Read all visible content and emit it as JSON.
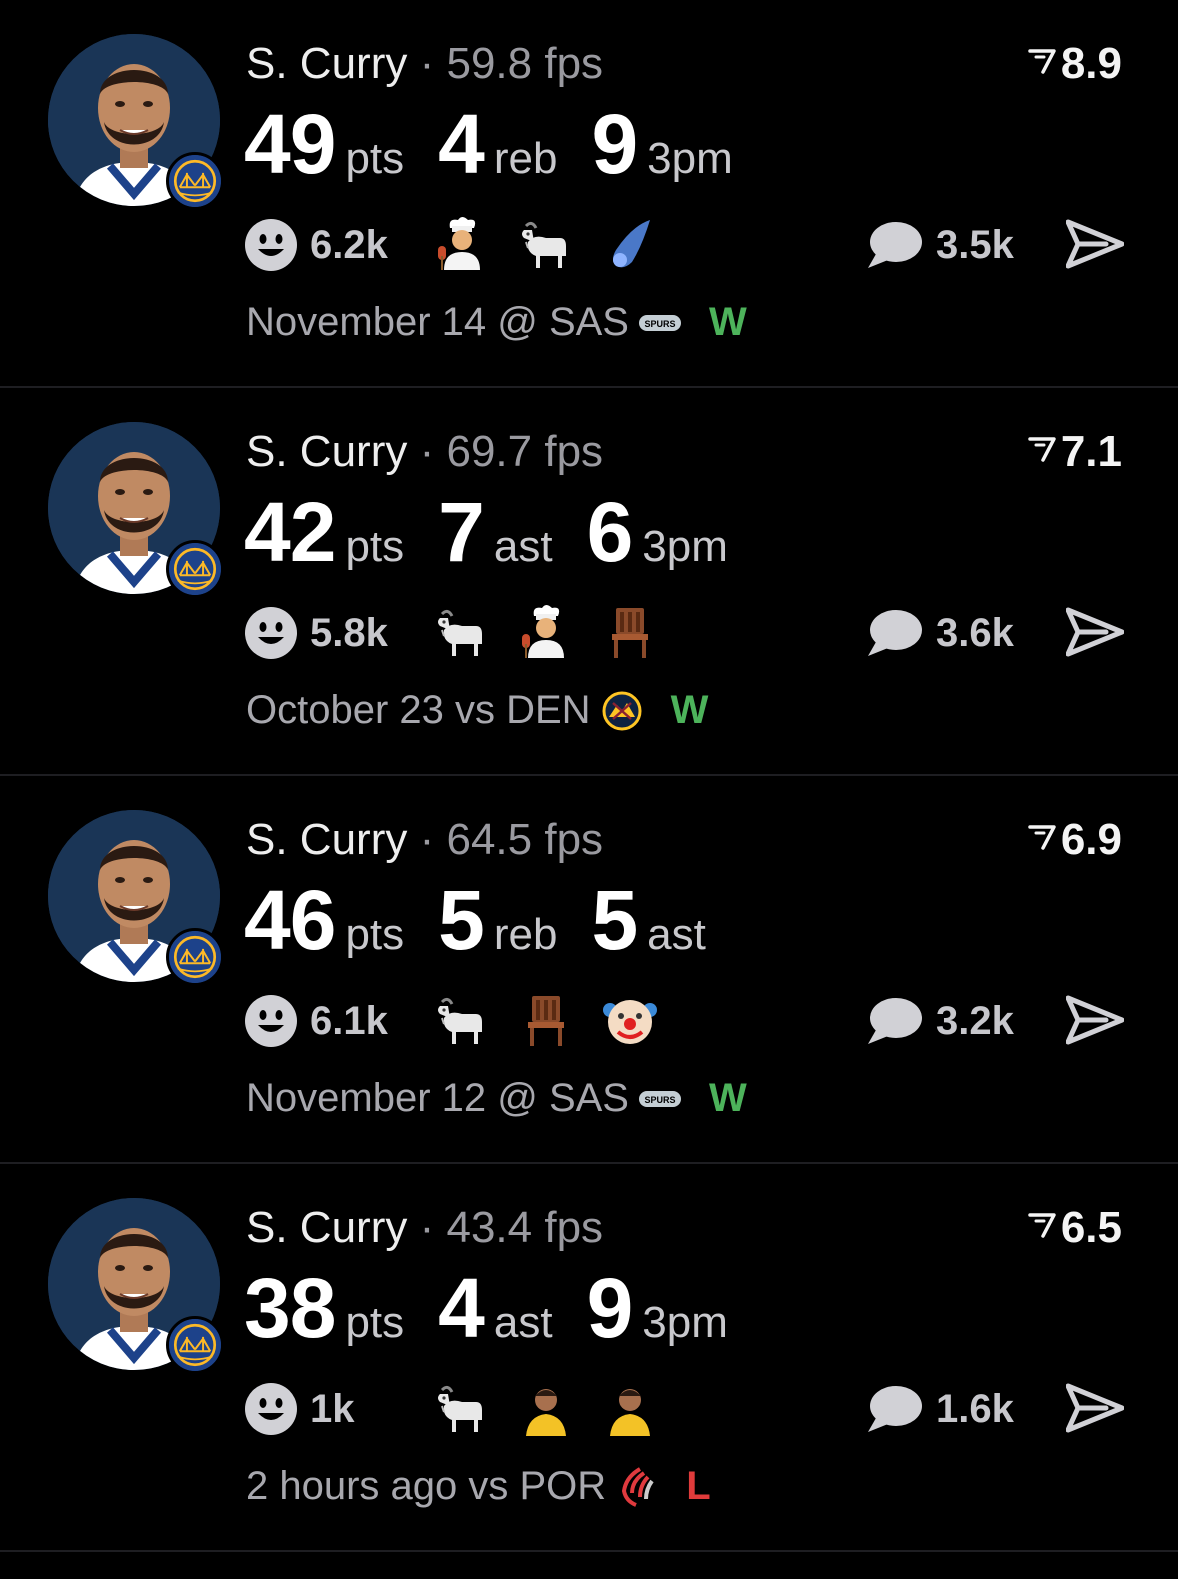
{
  "colors": {
    "win": "#4db35b",
    "loss": "#e03b3b",
    "background": "#000000",
    "avatar_bg": "#1a3556"
  },
  "posts": [
    {
      "player": "S. Curry",
      "separator": "·",
      "fps": "59.8 fps",
      "rating": "8.9",
      "stats": [
        {
          "value": "49",
          "unit": "pts"
        },
        {
          "value": "4",
          "unit": "reb"
        },
        {
          "value": "9",
          "unit": "3pm"
        }
      ],
      "reaction_count": "6.2k",
      "reaction_emojis": [
        "chef-emoji",
        "goat-emoji",
        "comet-emoji"
      ],
      "comment_count": "3.5k",
      "game": "November 14 @ SAS",
      "opponent_logo": "spurs-logo",
      "result": "W"
    },
    {
      "player": "S. Curry",
      "separator": "·",
      "fps": "69.7 fps",
      "rating": "7.1",
      "stats": [
        {
          "value": "42",
          "unit": "pts"
        },
        {
          "value": "7",
          "unit": "ast"
        },
        {
          "value": "6",
          "unit": "3pm"
        }
      ],
      "reaction_count": "5.8k",
      "reaction_emojis": [
        "goat-emoji",
        "chef-emoji",
        "chair-emoji"
      ],
      "comment_count": "3.6k",
      "game": "October 23 vs DEN",
      "opponent_logo": "nuggets-logo",
      "result": "W"
    },
    {
      "player": "S. Curry",
      "separator": "·",
      "fps": "64.5 fps",
      "rating": "6.9",
      "stats": [
        {
          "value": "46",
          "unit": "pts"
        },
        {
          "value": "5",
          "unit": "reb"
        },
        {
          "value": "5",
          "unit": "ast"
        }
      ],
      "reaction_count": "6.1k",
      "reaction_emojis": [
        "goat-emoji",
        "chair-emoji",
        "clown-emoji"
      ],
      "comment_count": "3.2k",
      "game": "November 12 @ SAS",
      "opponent_logo": "spurs-logo",
      "result": "W"
    },
    {
      "player": "S. Curry",
      "separator": "·",
      "fps": "43.4 fps",
      "rating": "6.5",
      "stats": [
        {
          "value": "38",
          "unit": "pts"
        },
        {
          "value": "4",
          "unit": "ast"
        },
        {
          "value": "9",
          "unit": "3pm"
        }
      ],
      "reaction_count": "1k",
      "reaction_emojis": [
        "goat-emoji",
        "custom-player-emoji",
        "custom-player-emoji"
      ],
      "comment_count": "1.6k",
      "game": "2 hours ago vs POR",
      "opponent_logo": "blazers-logo",
      "result": "L"
    }
  ]
}
